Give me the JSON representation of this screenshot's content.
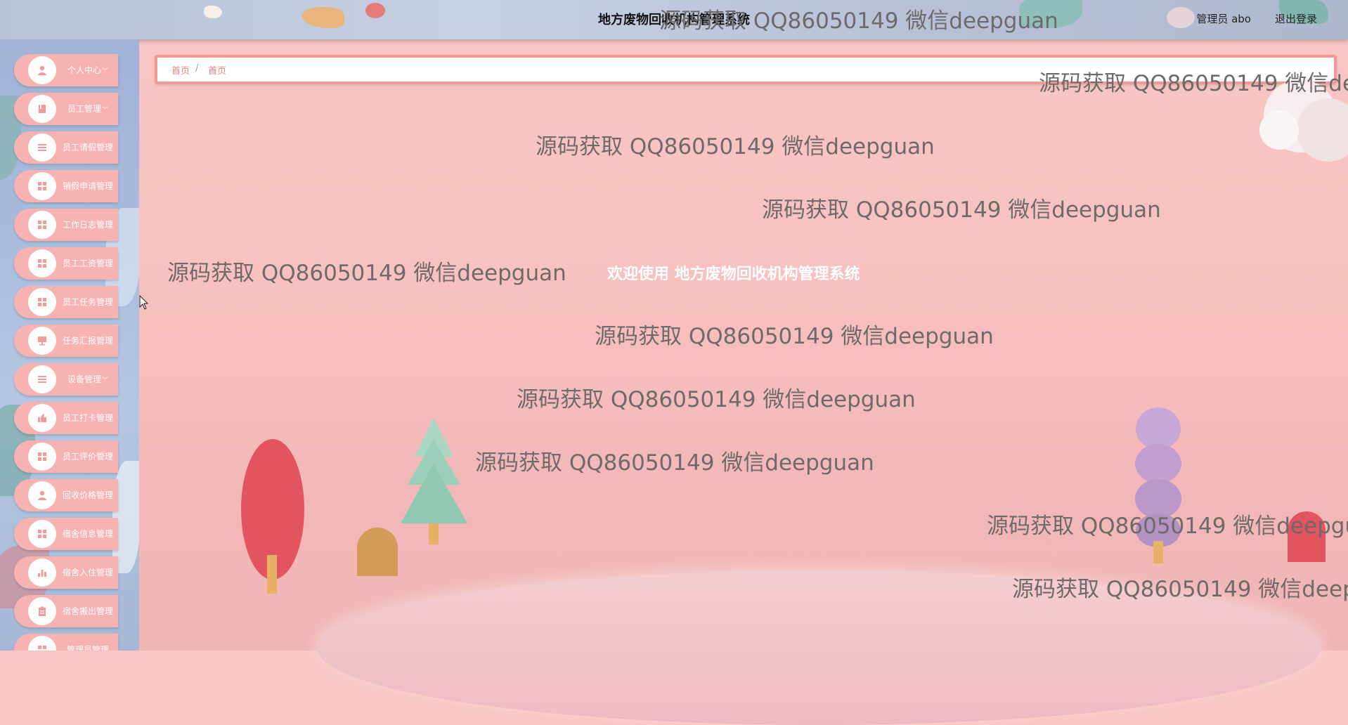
{
  "header": {
    "title": "地方废物回收机构管理系统",
    "user_label": "管理员 abo",
    "logout_label": "退出登录"
  },
  "sidebar": {
    "items": [
      {
        "label": "个人中心",
        "icon": "user-icon",
        "has_submenu": true
      },
      {
        "label": "员工管理",
        "icon": "book-icon",
        "has_submenu": true
      },
      {
        "label": "员工请假管理",
        "icon": "list-icon",
        "has_submenu": false
      },
      {
        "label": "销假申请管理",
        "icon": "grid-icon",
        "has_submenu": false
      },
      {
        "label": "工作日志管理",
        "icon": "grid-icon",
        "has_submenu": false
      },
      {
        "label": "员工工资管理",
        "icon": "grid-icon",
        "has_submenu": false
      },
      {
        "label": "员工任务管理",
        "icon": "grid-icon",
        "has_submenu": false
      },
      {
        "label": "任务汇报管理",
        "icon": "monitor-icon",
        "has_submenu": false
      },
      {
        "label": "设备管理",
        "icon": "list-icon",
        "has_submenu": true
      },
      {
        "label": "员工打卡管理",
        "icon": "thumb-icon",
        "has_submenu": false
      },
      {
        "label": "员工评价管理",
        "icon": "grid-icon",
        "has_submenu": false
      },
      {
        "label": "回收价格管理",
        "icon": "user-icon",
        "has_submenu": false
      },
      {
        "label": "宿舍信息管理",
        "icon": "grid-icon",
        "has_submenu": false
      },
      {
        "label": "宿舍入住管理",
        "icon": "bar-chart-icon",
        "has_submenu": false
      },
      {
        "label": "宿舍搬出管理",
        "icon": "clipboard-icon",
        "has_submenu": false
      },
      {
        "label": "管理员管理",
        "icon": "grid-icon",
        "has_submenu": false
      }
    ],
    "chevron": "﹀"
  },
  "breadcrumb": {
    "home": "首页",
    "separator": "/",
    "current": "首页"
  },
  "main": {
    "welcome": "欢迎使用 地方废物回收机构管理系统"
  },
  "watermark": {
    "text": "源码获取 QQ86050149 微信deepguan"
  },
  "colors": {
    "accent": "#f19a98",
    "menu_bg": "#f7b3b1",
    "background": "#f8c7c4"
  }
}
